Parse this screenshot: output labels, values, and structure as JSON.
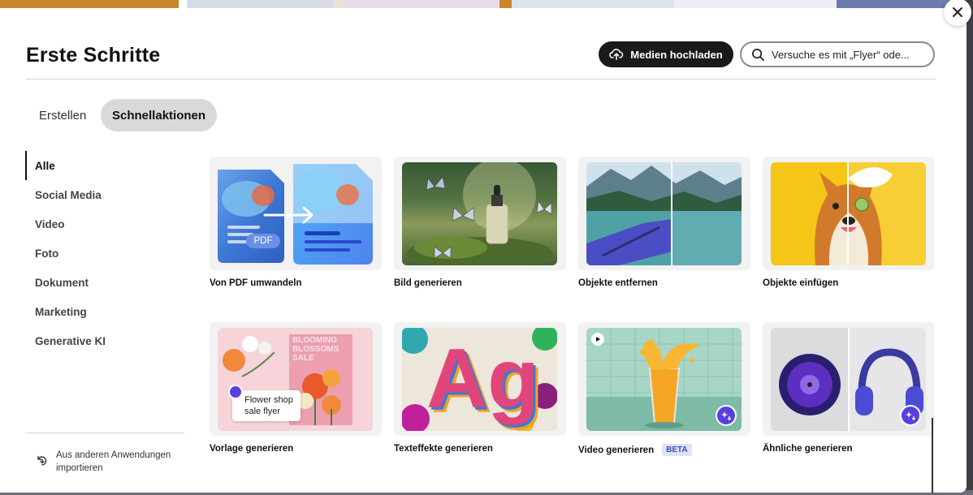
{
  "modal": {
    "title": "Erste Schritte",
    "upload_label": "Medien hochladen",
    "search_placeholder": "Versuche es mit „Flyer“ ode..."
  },
  "tabs": [
    {
      "label": "Erstellen",
      "active": false
    },
    {
      "label": "Schnellaktionen",
      "active": true
    }
  ],
  "sidebar": {
    "items": [
      {
        "label": "Alle",
        "active": true
      },
      {
        "label": "Social Media"
      },
      {
        "label": "Video"
      },
      {
        "label": "Foto"
      },
      {
        "label": "Dokument"
      },
      {
        "label": "Marketing"
      },
      {
        "label": "Generative KI"
      }
    ],
    "import_label_line1": "Aus anderen Anwendungen",
    "import_label_line2": "importieren"
  },
  "cards": [
    {
      "label": "Von PDF umwandeln",
      "pdf_badge": "PDF"
    },
    {
      "label": "Bild generieren"
    },
    {
      "label": "Objekte entfernen"
    },
    {
      "label": "Objekte einfügen"
    },
    {
      "label": "Vorlage generieren",
      "overlay_line1": "Flower shop",
      "overlay_line2": "sale flyer",
      "poster_text": "BLOOMING BLOSSOMS SALE"
    },
    {
      "label": "Texteffekte generieren",
      "art_text": "Ag"
    },
    {
      "label": "Video generieren",
      "badge": "BETA"
    },
    {
      "label": "Ähnliche generieren"
    }
  ],
  "icons": {
    "close": "close-icon",
    "upload": "cloud-upload-icon",
    "search": "search-icon",
    "import": "import-icon",
    "ai": "ai-sparkle-icon",
    "play": "play-icon"
  },
  "colors": {
    "accent_dark": "#1a1a1a",
    "ai_purple": "#5a3fe0",
    "beta_bg": "#dfe3f8",
    "beta_text": "#3b4cc0"
  }
}
